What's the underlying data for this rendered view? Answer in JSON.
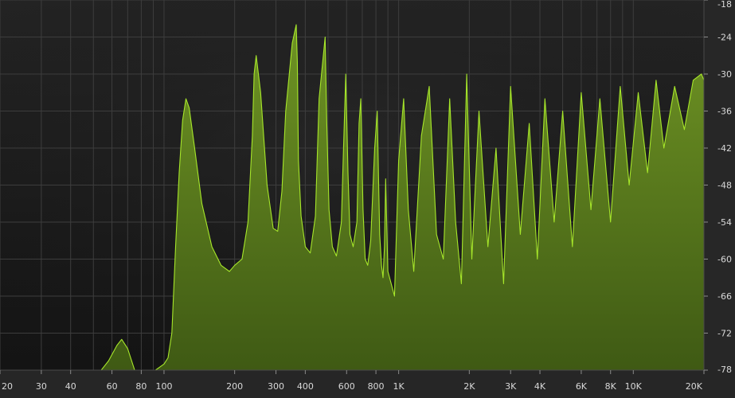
{
  "chart_data": {
    "type": "area",
    "x_scale": "log",
    "xlim": [
      20,
      20000
    ],
    "ylim": [
      -78,
      -18
    ],
    "grid": true,
    "x_ticks": [
      "20",
      "30",
      "40",
      "60",
      "80",
      "100",
      "200",
      "300",
      "400",
      "600",
      "800",
      "1K",
      "2K",
      "3K",
      "4K",
      "6K",
      "8K",
      "10K",
      "20K"
    ],
    "x_tick_values": [
      20,
      30,
      40,
      60,
      80,
      100,
      200,
      300,
      400,
      600,
      800,
      1000,
      2000,
      3000,
      4000,
      6000,
      8000,
      10000,
      20000
    ],
    "y_ticks": [
      "-18",
      "-24",
      "-30",
      "-36",
      "-42",
      "-48",
      "-54",
      "-60",
      "-66",
      "-72",
      "-78"
    ],
    "y_tick_values": [
      -18,
      -24,
      -30,
      -36,
      -42,
      -48,
      -54,
      -60,
      -66,
      -72,
      -78
    ],
    "series": [
      {
        "values_x": [
          54,
          58,
          63,
          66,
          70,
          75,
          80,
          92,
          100,
          104,
          108,
          112,
          116,
          120,
          124,
          128,
          135,
          145,
          160,
          175,
          190,
          200,
          215,
          228,
          238,
          242,
          247,
          258,
          275,
          292,
          305,
          318,
          330,
          352,
          366,
          370,
          374,
          384,
          400,
          420,
          442,
          458,
          486,
          494,
          505,
          522,
          543,
          570,
          582,
          595,
          608,
          620,
          640,
          664,
          678,
          690,
          705,
          720,
          738,
          760,
          790,
          810,
          830,
          845,
          858,
          870,
          880,
          900,
          930,
          960,
          1000,
          1050,
          1100,
          1160,
          1250,
          1350,
          1450,
          1550,
          1650,
          1750,
          1850,
          1950,
          2050,
          2200,
          2400,
          2600,
          2800,
          3000,
          3300,
          3600,
          3900,
          4200,
          4600,
          5000,
          5500,
          6000,
          6600,
          7200,
          8000,
          8800,
          9600,
          10500,
          11500,
          12500,
          13500,
          15000,
          16500,
          18000,
          19500,
          20000
        ],
        "values_y": [
          -78,
          -76.5,
          -74,
          -73,
          -74.5,
          -78,
          -78,
          -78,
          -77,
          -76,
          -72,
          -58,
          -46,
          -37.5,
          -34,
          -35.5,
          -42,
          -51,
          -58,
          -61,
          -62,
          -61,
          -60,
          -54,
          -40,
          -30,
          -27,
          -33,
          -48,
          -55,
          -55.5,
          -49,
          -36,
          -25,
          -22,
          -28,
          -44,
          -53,
          -58,
          -59,
          -53,
          -34,
          -24,
          -38,
          -52,
          -58,
          -59.5,
          -54,
          -42,
          -30,
          -46,
          -56,
          -58,
          -54,
          -38,
          -34,
          -52,
          -60,
          -61,
          -57,
          -42,
          -36,
          -56,
          -61,
          -63,
          -58,
          -47,
          -62,
          -64,
          -66,
          -44,
          -34,
          -52,
          -62,
          -40,
          -32,
          -56,
          -60,
          -34,
          -54,
          -64,
          -30,
          -60,
          -36,
          -58,
          -42,
          -64,
          -32,
          -56,
          -38,
          -60,
          -34,
          -54,
          -36,
          -58,
          -33,
          -52,
          -34,
          -54,
          -32,
          -48,
          -33,
          -46,
          -31,
          -42,
          -32,
          -39,
          -31,
          -30,
          -31
        ]
      }
    ]
  },
  "colors": {
    "plot_background": "#1e1e1e",
    "plot_background_top": "#2b2b2b",
    "grid": "#3d3d3d",
    "fill_top": "#6f9424",
    "fill_bottom": "#3f5a14",
    "stroke": "#a6e62a",
    "axis_panel": "#2a2a2a",
    "axis_text": "#d9d9d9"
  }
}
